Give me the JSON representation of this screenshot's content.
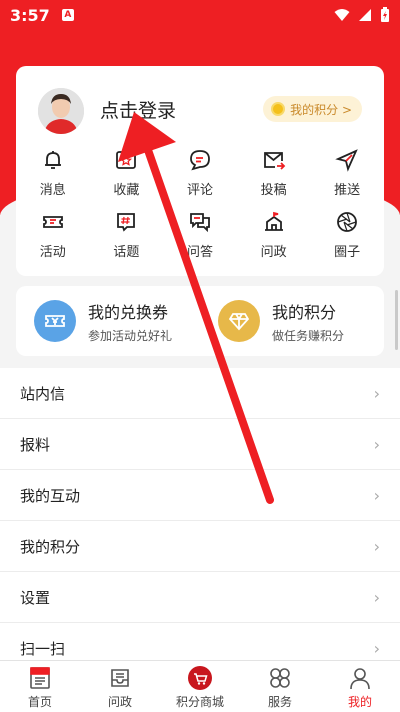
{
  "status_bar": {
    "time": "3:57",
    "badge": "A"
  },
  "profile": {
    "login_label": "点击登录",
    "points_label": "我的积分 >"
  },
  "grid_row1": [
    {
      "label": "消息",
      "icon": "bell-icon"
    },
    {
      "label": "收藏",
      "icon": "star-box-icon"
    },
    {
      "label": "评论",
      "icon": "comment-icon"
    },
    {
      "label": "投稿",
      "icon": "mail-send-icon"
    },
    {
      "label": "推送",
      "icon": "send-icon"
    }
  ],
  "grid_row2": [
    {
      "label": "活动",
      "icon": "ticket-icon"
    },
    {
      "label": "话题",
      "icon": "hashtag-icon"
    },
    {
      "label": "问答",
      "icon": "qa-icon"
    },
    {
      "label": "问政",
      "icon": "building-icon"
    },
    {
      "label": "圈子",
      "icon": "aperture-icon"
    }
  ],
  "coupons": {
    "exchange": {
      "title": "我的兑换券",
      "subtitle": "参加活动兑好礼"
    },
    "points": {
      "title": "我的积分",
      "subtitle": "做任务赚积分"
    }
  },
  "menu": [
    {
      "label": "站内信"
    },
    {
      "label": "报料"
    },
    {
      "label": "我的互动"
    },
    {
      "label": "我的积分"
    },
    {
      "label": "设置"
    },
    {
      "label": "扫一扫"
    }
  ],
  "tabbar": [
    {
      "label": "首页",
      "icon": "news-icon"
    },
    {
      "label": "问政",
      "icon": "inbox-icon"
    },
    {
      "label": "积分商城",
      "icon": "cart-icon"
    },
    {
      "label": "服务",
      "icon": "clover-icon"
    },
    {
      "label": "我的",
      "icon": "person-icon",
      "active": true
    }
  ],
  "colors": {
    "accent": "#ee1f23",
    "coupon_blue": "#5aa3e6",
    "coupon_gold": "#e7b849"
  }
}
